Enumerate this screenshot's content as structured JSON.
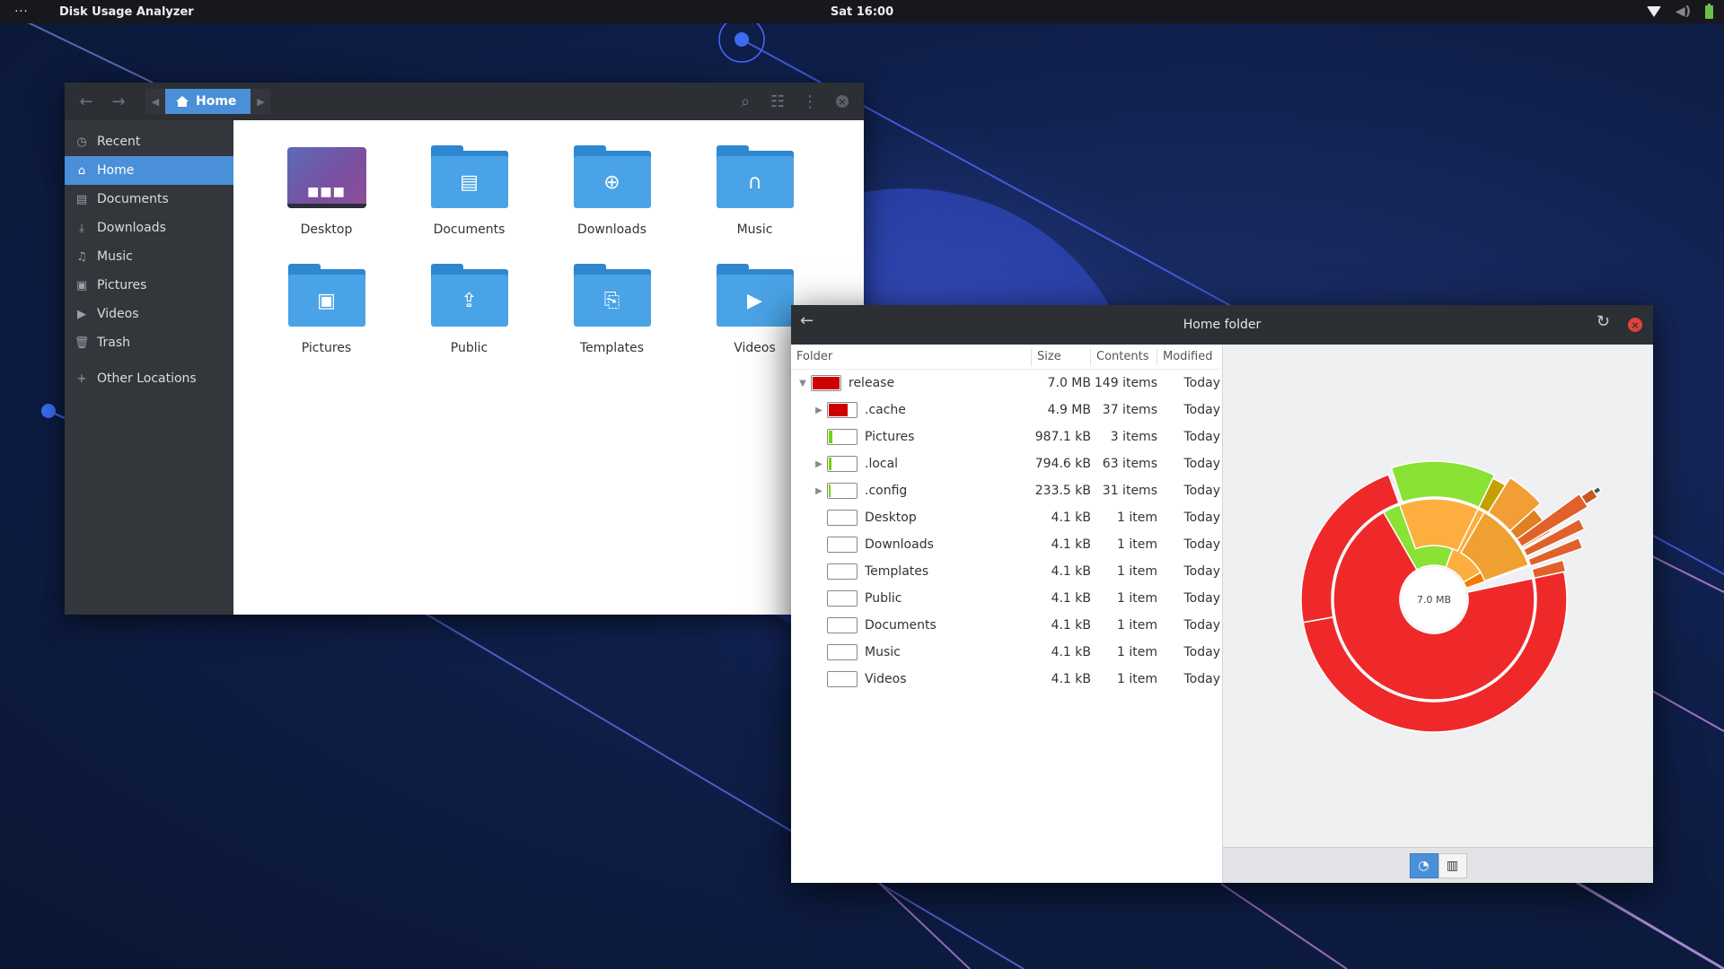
{
  "topbar": {
    "menu_dots": "···",
    "app_name": "Disk Usage Analyzer",
    "clock": "Sat 16:00",
    "icons": [
      "wifi-icon",
      "volume-icon",
      "battery-icon"
    ]
  },
  "files_window": {
    "breadcrumb": {
      "current": "Home"
    },
    "sidebar": [
      {
        "label": "Recent",
        "icon": "clock-icon",
        "active": false
      },
      {
        "label": "Home",
        "icon": "home-icon",
        "active": true
      },
      {
        "label": "Documents",
        "icon": "document-icon",
        "active": false
      },
      {
        "label": "Downloads",
        "icon": "download-icon",
        "active": false
      },
      {
        "label": "Music",
        "icon": "music-icon",
        "active": false
      },
      {
        "label": "Pictures",
        "icon": "picture-icon",
        "active": false
      },
      {
        "label": "Videos",
        "icon": "video-icon",
        "active": false
      },
      {
        "label": "Trash",
        "icon": "trash-icon",
        "active": false
      }
    ],
    "other_locations": "Other Locations",
    "folders": [
      {
        "label": "Desktop",
        "icon": "desktop-icon"
      },
      {
        "label": "Documents",
        "icon": "document-icon"
      },
      {
        "label": "Downloads",
        "icon": "download-icon"
      },
      {
        "label": "Music",
        "icon": "headphones-icon"
      },
      {
        "label": "Pictures",
        "icon": "picture-icon"
      },
      {
        "label": "Public",
        "icon": "share-icon"
      },
      {
        "label": "Templates",
        "icon": "template-icon"
      },
      {
        "label": "Videos",
        "icon": "video-icon"
      }
    ]
  },
  "dua_window": {
    "title": "Home folder",
    "columns": {
      "folder": "Folder",
      "size": "Size",
      "contents": "Contents",
      "modified": "Modified"
    },
    "rows": [
      {
        "name": "release",
        "size": "7.0 MB",
        "contents": "149 items",
        "modified": "Today",
        "expander": "down",
        "usage": 1.0
      },
      {
        "name": ".cache",
        "size": "4.9 MB",
        "contents": "37 items",
        "modified": "Today",
        "expander": "right",
        "usage": 0.7
      },
      {
        "name": "Pictures",
        "size": "987.1 kB",
        "contents": "3 items",
        "modified": "Today",
        "expander": "",
        "usage": 0.14
      },
      {
        "name": ".local",
        "size": "794.6 kB",
        "contents": "63 items",
        "modified": "Today",
        "expander": "right",
        "usage": 0.11
      },
      {
        "name": ".config",
        "size": "233.5 kB",
        "contents": "31 items",
        "modified": "Today",
        "expander": "right",
        "usage": 0.03
      },
      {
        "name": "Desktop",
        "size": "4.1 kB",
        "contents": "1 item",
        "modified": "Today",
        "expander": "",
        "usage": 0
      },
      {
        "name": "Downloads",
        "size": "4.1 kB",
        "contents": "1 item",
        "modified": "Today",
        "expander": "",
        "usage": 0
      },
      {
        "name": "Templates",
        "size": "4.1 kB",
        "contents": "1 item",
        "modified": "Today",
        "expander": "",
        "usage": 0
      },
      {
        "name": "Public",
        "size": "4.1 kB",
        "contents": "1 item",
        "modified": "Today",
        "expander": "",
        "usage": 0
      },
      {
        "name": "Documents",
        "size": "4.1 kB",
        "contents": "1 item",
        "modified": "Today",
        "expander": "",
        "usage": 0
      },
      {
        "name": "Music",
        "size": "4.1 kB",
        "contents": "1 item",
        "modified": "Today",
        "expander": "",
        "usage": 0
      },
      {
        "name": "Videos",
        "size": "4.1 kB",
        "contents": "1 item",
        "modified": "Today",
        "expander": "",
        "usage": 0
      }
    ],
    "bar_colors": {
      "red": "#cc0000",
      "green": "#73d216"
    },
    "chart_center_label": "7.0 MB",
    "chart_toggle": [
      {
        "icon": "ring-chart-icon",
        "active": true
      },
      {
        "icon": "treemap-icon",
        "active": false
      }
    ]
  },
  "chart_data": {
    "type": "sunburst",
    "center_label": "7.0 MB",
    "rings": [
      {
        "level": 1,
        "segments": [
          {
            "name": ".cache",
            "fraction": 0.7,
            "color": "#ef2929"
          },
          {
            "name": "Pictures",
            "fraction": 0.14,
            "color": "#8ae234"
          },
          {
            "name": ".local",
            "fraction": 0.11,
            "color": "#fcaf3e"
          },
          {
            "name": ".config",
            "fraction": 0.03,
            "color": "#f57900"
          }
        ]
      }
    ]
  }
}
